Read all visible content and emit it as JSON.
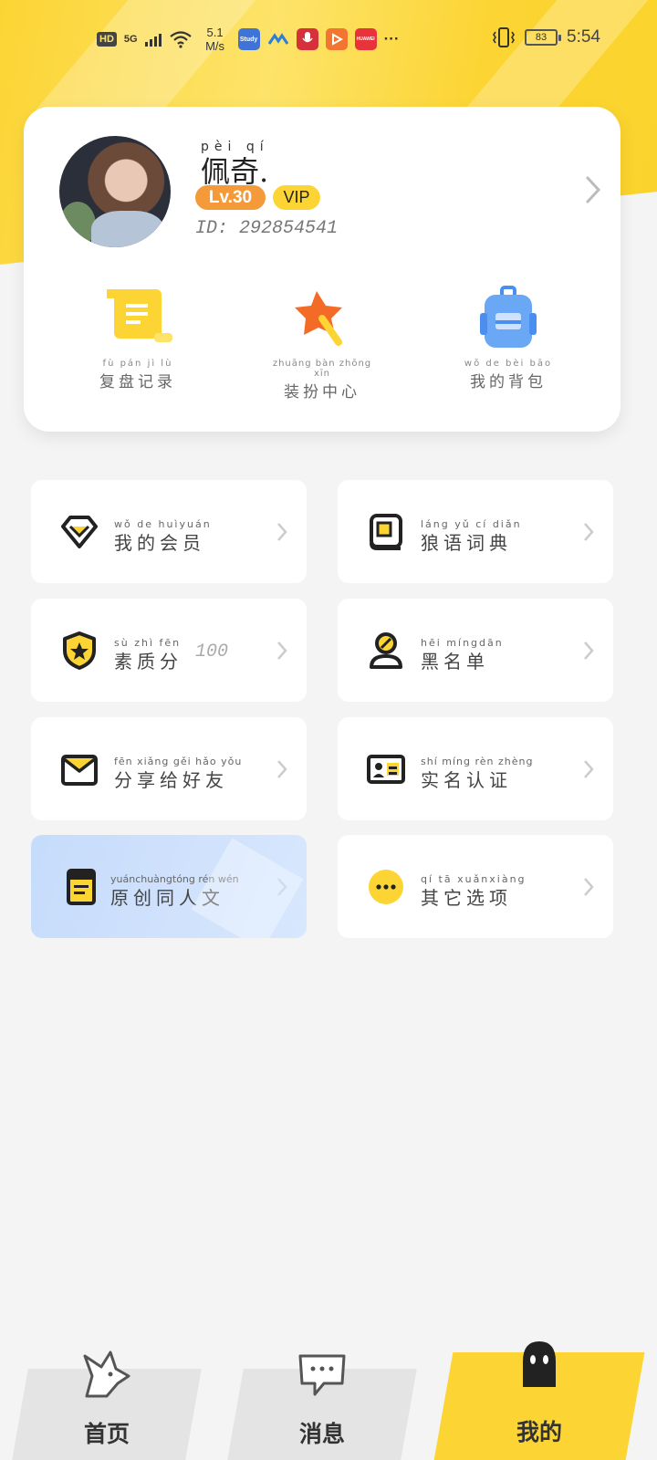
{
  "status_bar": {
    "hd": "HD",
    "network": "5G",
    "speed_top": "5.1",
    "speed_bottom": "M/s",
    "battery": "83",
    "time": "5:54",
    "more": "···",
    "apps": [
      {
        "name": "study-app-icon",
        "label": "Study",
        "color": "#3f74d6"
      },
      {
        "name": "blue-app-icon",
        "label": "",
        "color": "#2a7fd8"
      },
      {
        "name": "recorder-app-icon",
        "label": "",
        "color": "#d6303a"
      },
      {
        "name": "video-app-icon",
        "label": "",
        "color": "#f2762f"
      },
      {
        "name": "huawei-store-icon",
        "label": "HUAWEI",
        "color": "#e8333b"
      }
    ]
  },
  "profile": {
    "name": "佩奇.",
    "name_pinyin": "pèi qí",
    "level": "Lv.30",
    "vip": "VIP",
    "user_id": "ID: 292854541"
  },
  "quick_actions": [
    {
      "pinyin": "fù pán jì lù",
      "label": "复盘记录",
      "icon": "scroll-icon"
    },
    {
      "pinyin": "zhuāng bàn zhōng xīn",
      "label": "装扮中心",
      "icon": "magic-wand-icon"
    },
    {
      "pinyin": "wǒ de bèi bāo",
      "label": "我的背包",
      "icon": "backpack-icon"
    }
  ],
  "menu": [
    {
      "pinyin": "wǒ de huìyuán",
      "label": "我的会员",
      "icon": "diamond-icon"
    },
    {
      "pinyin": "láng yǔ cí diǎn",
      "label": "狼语词典",
      "icon": "dictionary-icon"
    },
    {
      "pinyin": "sù zhì fēn",
      "label": "素质分",
      "extra": "100",
      "icon": "shield-star-icon"
    },
    {
      "pinyin": "hēi míngdān",
      "label": "黑名单",
      "icon": "blocked-user-icon"
    },
    {
      "pinyin": "fēn xiǎng gěi hǎo yǒu",
      "label": "分享给好友",
      "icon": "envelope-icon"
    },
    {
      "pinyin": "shí míng rèn zhèng",
      "label": "实名认证",
      "icon": "id-card-icon"
    },
    {
      "pinyin": "yuánchuàngtóng rén wén",
      "label": "原创同人文",
      "icon": "notebook-icon"
    },
    {
      "pinyin": "qí tā xuǎnxiàng",
      "label": "其它选项",
      "icon": "more-dots-icon"
    }
  ],
  "nav": {
    "home": "首页",
    "messages": "消息",
    "mine": "我的",
    "active": "mine"
  },
  "colors": {
    "accent": "#fcd534",
    "level_badge": "#f49a38",
    "background": "#f4f4f4"
  }
}
